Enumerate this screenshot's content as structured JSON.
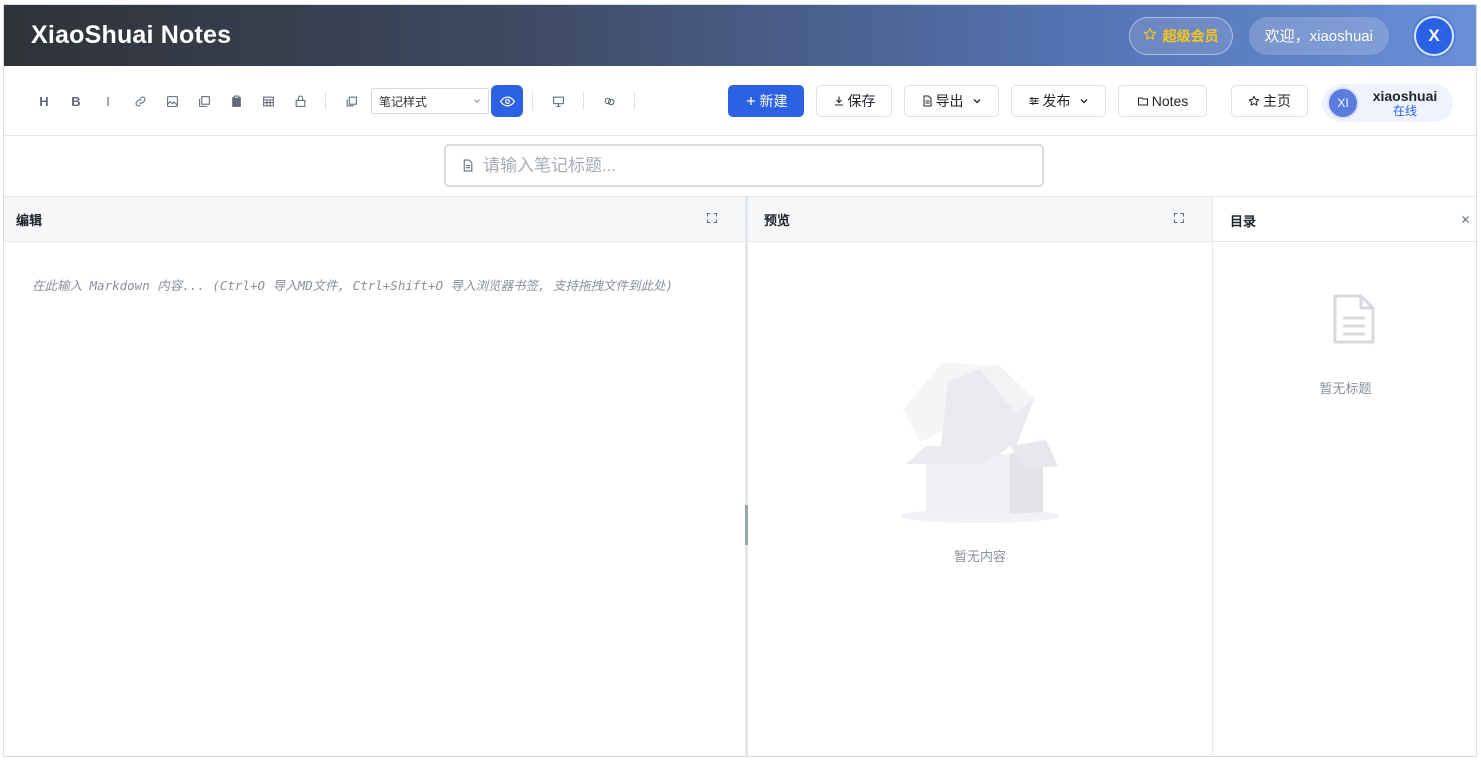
{
  "app": {
    "title": "XiaoShuai Notes",
    "vip_label": "超级会员",
    "welcome": "欢迎，xiaoshuai",
    "avatar_letter": "X"
  },
  "toolbar": {
    "format_buttons": [
      "H",
      "B",
      "I"
    ],
    "style_select": {
      "value": "笔记样式"
    },
    "actions": {
      "new": "新建",
      "save": "保存",
      "export": "导出",
      "publish": "发布",
      "notes": "Notes",
      "home": "主页"
    }
  },
  "user": {
    "initials": "XI",
    "name": "xiaoshuai",
    "status": "在线"
  },
  "note_title": {
    "placeholder": "请输入笔记标题...",
    "value": ""
  },
  "editor": {
    "label": "编辑",
    "placeholder": "在此输入 Markdown 内容... (Ctrl+O 导入MD文件, Ctrl+Shift+O 导入浏览器书签, 支持拖拽文件到此处)"
  },
  "preview": {
    "label": "预览",
    "empty_text": "暂无内容"
  },
  "toc": {
    "label": "目录",
    "empty_text": "暂无标题"
  },
  "colors": {
    "primary": "#2b62e3",
    "vip_gold": "#f5c518",
    "header_gradient_start": "#2f3237",
    "header_gradient_end": "#6a8fd6"
  }
}
